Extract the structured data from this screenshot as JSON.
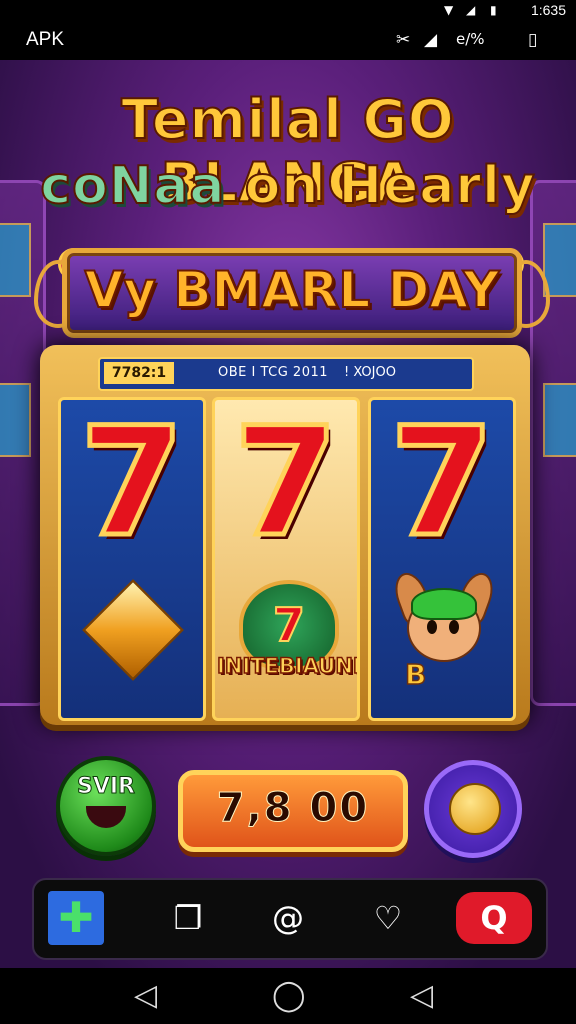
{
  "status_bar": {
    "time": "1:635",
    "icons": [
      "wifi-icon",
      "signal-icon",
      "battery-icon"
    ]
  },
  "app_bar": {
    "title": "APK",
    "icons": [
      "tool-icon",
      "signal-icon",
      "data-icon",
      "battery-icon"
    ],
    "data_text": "e/%"
  },
  "game": {
    "headline_line1": "Temilal GO BLANGA",
    "headline_line2_a": "coNaa ",
    "headline_line2_b": "on Hearly",
    "banner": "Vy BMARL DAY",
    "info_left": "7782:1",
    "info_center": "OBE I TCG 2011",
    "info_right": "! XOJOO",
    "reels": [
      {
        "top_symbol": "7",
        "bottom_symbol": "gem-icon"
      },
      {
        "top_symbol": "7",
        "bottom_symbol": "badge-icon",
        "badge_symbol": "7",
        "badge_label": "INITEBIAUNHA"
      },
      {
        "top_symbol": "7",
        "bottom_symbol": "creature-icon",
        "creature_tag": "B"
      }
    ],
    "spin_label": "SVIR",
    "credit_value": "7,8 00"
  },
  "tab_bar": {
    "items": [
      {
        "icon": "plus-icon",
        "glyph": "✚"
      },
      {
        "icon": "bookmark-icon",
        "glyph": "❐"
      },
      {
        "icon": "at-icon",
        "glyph": "@"
      },
      {
        "icon": "heart-icon",
        "glyph": "♡"
      },
      {
        "icon": "search-icon",
        "glyph": "Q"
      }
    ]
  },
  "nav_bar": {
    "back": "◁",
    "home": "◯",
    "recent": "◁"
  },
  "colors": {
    "accent_gold": "#ffc83a",
    "seven_red": "#e4121d",
    "reel_blue": "#1d4aa8"
  }
}
